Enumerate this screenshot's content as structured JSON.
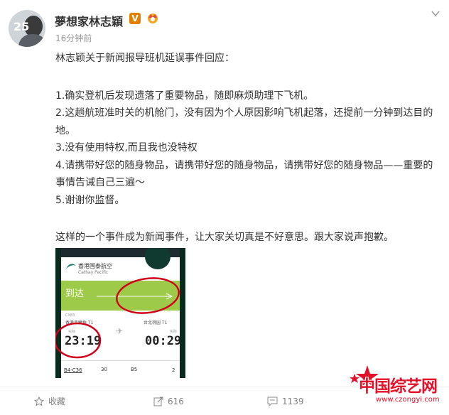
{
  "post": {
    "author": "夢想家林志穎",
    "verified_badge": "V",
    "time": "16分钟前",
    "intro": "林志颖关于新闻报导班机延误事件回应：",
    "points": [
      "1.确实登机后发现遗落了重要物品，随即麻烦助理下飞机。",
      "2.这趟航班准时关的机舱门，没有因为个人原因影响飞机起落，还提前一分钟到达目的地。",
      "3.没有使用特权,而且我也没特权",
      "4.请携带好您的随身物品，请携带好您的随身物品，请携带好您的随身物品——重要的事情告诫自己三遍～",
      "5.谢谢你监督。"
    ],
    "closing": "这样的一个事件成为新闻事件，让大家关切真是不好意思。跟大家说声抱歉。"
  },
  "photo": {
    "airline": "香港国泰航空",
    "airline_sub": "Cathay Pacific",
    "status": "到达",
    "flight_no": "CX83",
    "dep_terminal": "香港赤鱲角 T1",
    "arr_terminal": "台北桃园 T1",
    "dep_label": "实际",
    "arr_label": "实际",
    "dep_time": "23:19",
    "arr_time": "00:29",
    "gate": "B4-C36",
    "seat": "30",
    "belt": "B5",
    "count": "2"
  },
  "footer": {
    "favorite_label": "收藏",
    "repost_count": "616",
    "comment_count": "1139"
  },
  "watermark": {
    "main": "中国综艺网",
    "sub": "www.czongyi.com"
  },
  "colors": {
    "accent_orange": "#e38000",
    "green": "#9dcb49",
    "watermark_red": "#e3122b",
    "marker_red": "#d0021b"
  },
  "icons": {
    "favorite": "star-icon",
    "repost": "repost-icon",
    "comment": "comment-icon",
    "menu": "chevron-down-icon"
  }
}
